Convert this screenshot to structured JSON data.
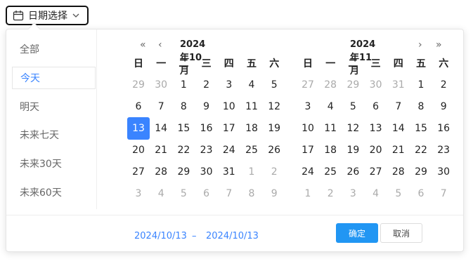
{
  "trigger": {
    "label": "日期选择",
    "icon": "calendar-icon",
    "chevron": "chevron-down-icon"
  },
  "shortcuts": [
    {
      "label": "全部",
      "active": false
    },
    {
      "label": "今天",
      "active": true
    },
    {
      "label": "明天",
      "active": false
    },
    {
      "label": "未来七天",
      "active": false
    },
    {
      "label": "未来30天",
      "active": false
    },
    {
      "label": "未来60天",
      "active": false
    }
  ],
  "weekdays": [
    "日",
    "一",
    "二",
    "三",
    "四",
    "五",
    "六"
  ],
  "left_calendar": {
    "title": "2024年10月",
    "nav_prev_year": "«",
    "nav_prev_month": "‹",
    "weeks": [
      [
        "29",
        "30",
        "1",
        "2",
        "3",
        "4",
        "5"
      ],
      [
        "6",
        "7",
        "8",
        "9",
        "10",
        "11",
        "12"
      ],
      [
        "13",
        "14",
        "15",
        "16",
        "17",
        "18",
        "19"
      ],
      [
        "20",
        "21",
        "22",
        "23",
        "24",
        "25",
        "26"
      ],
      [
        "27",
        "28",
        "29",
        "30",
        "31",
        "1",
        "2"
      ],
      [
        "3",
        "4",
        "5",
        "6",
        "7",
        "8",
        "9"
      ]
    ],
    "other_month_cells": [
      [
        0,
        0
      ],
      [
        0,
        1
      ],
      [
        4,
        5
      ],
      [
        4,
        6
      ],
      [
        5,
        0
      ],
      [
        5,
        1
      ],
      [
        5,
        2
      ],
      [
        5,
        3
      ],
      [
        5,
        4
      ],
      [
        5,
        5
      ],
      [
        5,
        6
      ]
    ],
    "selected_cell": [
      2,
      0
    ]
  },
  "right_calendar": {
    "title": "2024年11月",
    "nav_next_month": "›",
    "nav_next_year": "»",
    "weeks": [
      [
        "27",
        "28",
        "29",
        "30",
        "31",
        "1",
        "2"
      ],
      [
        "3",
        "4",
        "5",
        "6",
        "7",
        "8",
        "9"
      ],
      [
        "10",
        "11",
        "12",
        "13",
        "14",
        "15",
        "16"
      ],
      [
        "17",
        "18",
        "19",
        "20",
        "21",
        "22",
        "23"
      ],
      [
        "24",
        "25",
        "26",
        "27",
        "28",
        "29",
        "30"
      ],
      [
        "1",
        "2",
        "3",
        "4",
        "5",
        "6",
        "7"
      ]
    ],
    "other_month_cells": [
      [
        0,
        0
      ],
      [
        0,
        1
      ],
      [
        0,
        2
      ],
      [
        0,
        3
      ],
      [
        0,
        4
      ],
      [
        5,
        0
      ],
      [
        5,
        1
      ],
      [
        5,
        2
      ],
      [
        5,
        3
      ],
      [
        5,
        4
      ],
      [
        5,
        5
      ],
      [
        5,
        6
      ]
    ]
  },
  "footer": {
    "start_date": "2024/10/13",
    "separator": "–",
    "end_date": "2024/10/13",
    "confirm_label": "确定",
    "cancel_label": "取消"
  },
  "colors": {
    "accent": "#3a84ff",
    "confirm_bg": "#2196f3",
    "muted": "#aaaaaa"
  }
}
